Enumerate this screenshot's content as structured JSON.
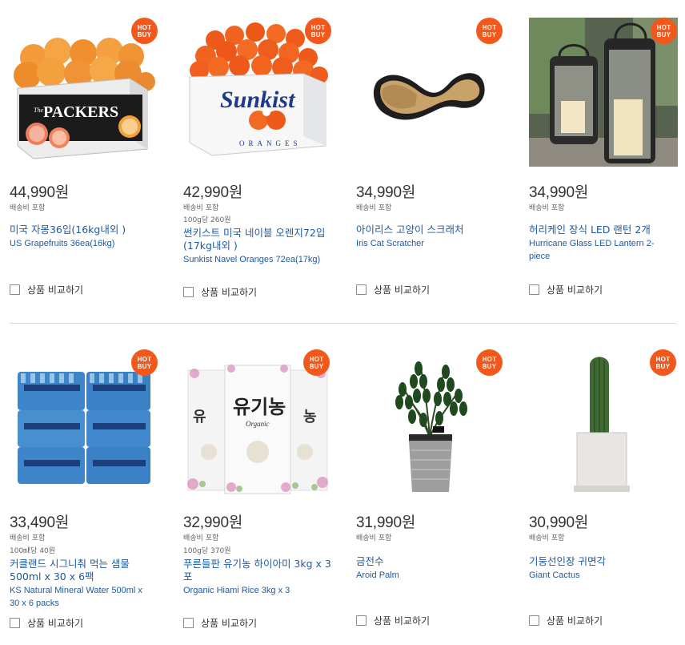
{
  "products": [
    {
      "badge": [
        "HOT",
        "BUY"
      ],
      "price": "44,990원",
      "shipping": "배송비 포함",
      "unit_price": "",
      "name_ko": "미국 자몽36입(16kg내외 )",
      "name_en": "US Grapefruits 36ea(16kg)",
      "compare": "상품 비교하기",
      "image": "grapefruit-box",
      "box_text": "PACKERS"
    },
    {
      "badge": [
        "HOT",
        "BUY"
      ],
      "price": "42,990원",
      "shipping": "배송비 포함",
      "unit_price": "100g당 260원",
      "name_ko": "썬키스트 미국 네이블 오렌지72입 (17kg내외 )",
      "name_en": "Sunkist Navel Oranges 72ea(17kg)",
      "compare": "상품 비교하기",
      "image": "orange-box",
      "box_text": "Sunkist",
      "box_sub": "ORANGES"
    },
    {
      "badge": [
        "HOT",
        "BUY"
      ],
      "price": "34,990원",
      "shipping": "배송비 포함",
      "unit_price": "",
      "name_ko": "아이리스 고양이 스크래처",
      "name_en": "Iris Cat Scratcher",
      "compare": "상품 비교하기",
      "image": "cat-scratcher"
    },
    {
      "badge": [
        "HOT",
        "BUY"
      ],
      "price": "34,990원",
      "shipping": "배송비 포함",
      "unit_price": "",
      "name_ko": "허리케인 장식 LED 랜턴 2개",
      "name_en": "Hurricane Glass LED Lantern 2-piece",
      "compare": "상품 비교하기",
      "image": "lanterns"
    },
    {
      "badge": [
        "HOT",
        "BUY"
      ],
      "price": "33,490원",
      "shipping": "배송비 포함",
      "unit_price": "100㎖당 40원",
      "name_ko": "커클랜드 시그니춰 먹는 샘물 500ml x 30 x 6팩",
      "name_en": "KS Natural Mineral Water 500ml x 30 x 6 packs",
      "compare": "상품 비교하기",
      "image": "water-packs"
    },
    {
      "badge": [
        "HOT",
        "BUY"
      ],
      "price": "32,990원",
      "shipping": "배송비 포함",
      "unit_price": "100g당 370원",
      "name_ko": "푸른들판 유기농 하이아미 3kg x 3포",
      "name_en": "Organic Hiami Rice 3kg x 3",
      "compare": "상품 비교하기",
      "image": "rice-bags",
      "bag_text": "유기농",
      "bag_sub": "Organic"
    },
    {
      "badge": [
        "HOT",
        "BUY"
      ],
      "price": "31,990원",
      "shipping": "배송비 포함",
      "unit_price": "",
      "name_ko": "금전수",
      "name_en": "Aroid Palm",
      "compare": "상품 비교하기",
      "image": "aroid-palm"
    },
    {
      "badge": [
        "HOT",
        "BUY"
      ],
      "price": "30,990원",
      "shipping": "배송비 포함",
      "unit_price": "",
      "name_ko": "기둥선인장 귀면각",
      "name_en": "Giant Cactus",
      "compare": "상품 비교하기",
      "image": "cactus"
    }
  ]
}
